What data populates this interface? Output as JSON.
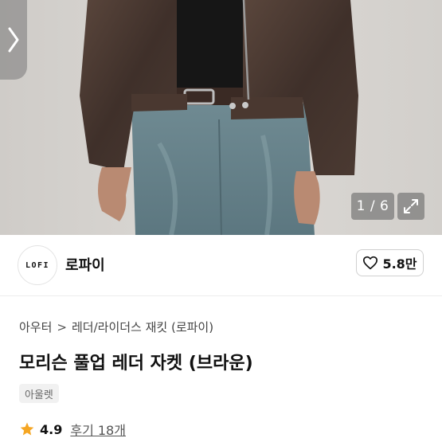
{
  "gallery": {
    "counter": "1 / 6",
    "back_icon": "chevron-right-icon",
    "expand_icon": "expand-icon"
  },
  "seller": {
    "logo_text": "LOFI",
    "name": "로파이",
    "likes": "5.8만",
    "like_icon": "heart-outline-icon"
  },
  "breadcrumb": {
    "items": [
      "아우터",
      "레더/라이더스 재킷 (로파이)"
    ],
    "separator": ">"
  },
  "product": {
    "title": "모리슨 풀업 레더 자켓 (브라운)",
    "tag": "아울렛"
  },
  "rating": {
    "score": "4.9",
    "reviews": "후기 18개",
    "star_color": "#f5a623"
  }
}
